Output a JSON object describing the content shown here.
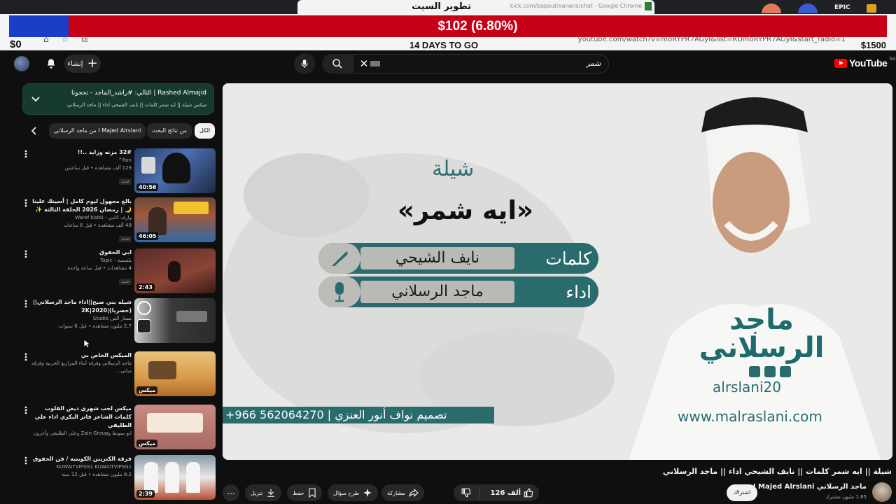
{
  "stream_overlay": {
    "browser_tab_title": "تطوير السيت",
    "browser_tab_url": "kick.com/popout/xanons/chat - Google Chrome",
    "progress_amount": "$102 (6.80%)",
    "progress_fraction": 0.068,
    "goal_start": "$0",
    "goal_end": "$1500",
    "days_left": "14 DAYS TO GO",
    "address_bar_url": "youtube.com/watch?v=moRYPR7AGyI&list=RDmoRYPR7AGyI&start_radio=1",
    "corner_label": "EPIC",
    "colors": {
      "red_bar": "#c60016",
      "blue_bar": "#1a3ec8"
    }
  },
  "header": {
    "create_label": "إنشاء",
    "search_query": "شمر",
    "logo_text": "YouTube",
    "country_code": "SA"
  },
  "playlist": {
    "next_label": "التالي: #راشد_الماجد - تحجونا | Rashed Almajid",
    "current_label": "ميكس شيلة || ايه شمر كلمات || نايف الشيحي اداء || ماجد الرسلاني",
    "chips": [
      {
        "label": "الكل",
        "active": true
      },
      {
        "label": "من نتائج البحث",
        "active": false
      },
      {
        "label": "من ماجد الرسلاني I Majed Alrslani",
        "active": false
      }
    ]
  },
  "recommendations": [
    {
      "title": "32# مزنه وزايد ..!!",
      "channel": "Ron^",
      "meta": "129 ألف مشاهدة • قبل ساعتين",
      "badge": "جديد",
      "duration": "40:56"
    },
    {
      "title": "بالغ مجهول ليوم كامل | أسيتك علينا 🌙 | رمضان 2026 الحلقة الثالثة ✨",
      "channel": "وارف كاتبي - Waref Katbi",
      "meta": "49 ألف مشاهدة • قبل 6 ساعات",
      "badge": "جديد",
      "duration": "46:05"
    },
    {
      "title": "ابي الخفوق",
      "channel": "بلسمية - Topic",
      "meta": "4 مشاهدات • قبل ساعة واحدة",
      "badge": "جديد",
      "duration": "2:43"
    },
    {
      "title": "شيله بني صبح||اداء ماجد الرسلاني|| (حصريا)|2020|2K",
      "channel": "مسار الفن Studio",
      "meta": "2.7 مليون مشاهدة • قبل 6 سنوات",
      "badge": "",
      "duration": ""
    },
    {
      "title": "الميكس الخاص بي",
      "channel": "ماجد الرسلاني وفرقة أبناء المزاريع الحربية وفرقه مباني...",
      "meta": "",
      "badge": "",
      "duration": "ميكس"
    },
    {
      "title": "ميكس لحب شهري ديض القلوب كلمات الشاعر فاتر البكري اداء علي الطليقي",
      "channel": "ابو سويط وZain Group وعلي الطليقي وآخرون",
      "meta": "",
      "badge": "",
      "duration": "ميكس"
    },
    {
      "title": "فرقة الكتزيين الكويتيه / فن الخفوق",
      "channel": "KUWAITVIPSG1 KUWAITVIPSG1",
      "meta": "8.2 مليون مشاهدة • قبل 12 سنة",
      "badge": "",
      "duration": "2:39"
    }
  ],
  "player": {
    "poster_top": "شيلة",
    "poster_song": "«ايه شمر»",
    "lyrics_tag": "كلمات",
    "lyrics_name": "نايف الشيحي",
    "performer_tag": "اداء",
    "performer_name": "ماجد الرسلاني",
    "designer_line": "+966 562064270 | تصميم نواف أنور العنزي",
    "brand_name": "ماجد الرسلاني",
    "brand_handle": "alrslani20",
    "brand_site": "www.malraslani.com"
  },
  "video": {
    "title": "شيلة || ايه شمر كلمات || نايف الشيحي اداء || ماجد الرسلاني",
    "channel_name": "ماجد الرسلاني I Majed Alrslani",
    "channel_subs": "1.65 مليون مشترك",
    "subscribe_label": "اشتراك",
    "like_count": "126 ألف",
    "share_label": "مشاركة",
    "ask_label": "طرح سؤال",
    "save_label": "حفظ",
    "download_label": "تنزيل",
    "more_label": "..."
  }
}
